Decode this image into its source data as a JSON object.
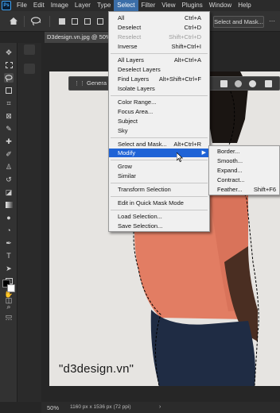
{
  "menubar": {
    "logo": "Ps",
    "items": [
      "File",
      "Edit",
      "Image",
      "Layer",
      "Type",
      "Select",
      "Filter",
      "View",
      "Plugins",
      "Window",
      "Help"
    ],
    "active": "Select"
  },
  "options": {
    "select_and_mask": "Select and Mask..."
  },
  "document": {
    "tab_title": "D3design.vn.jpg @ 50% (",
    "zoom": "50%",
    "dimensions": "1160 px x 1536 px (72 ppi)",
    "watermark": "\"d3design.vn\"",
    "context_label": "Genera"
  },
  "select_menu": {
    "all": {
      "label": "All",
      "shortcut": "Ctrl+A"
    },
    "deselect": {
      "label": "Deselect",
      "shortcut": "Ctrl+D"
    },
    "reselect": {
      "label": "Reselect",
      "shortcut": "Shift+Ctrl+D"
    },
    "inverse": {
      "label": "Inverse",
      "shortcut": "Shift+Ctrl+I"
    },
    "all_layers": {
      "label": "All Layers",
      "shortcut": "Alt+Ctrl+A"
    },
    "deselect_layers": {
      "label": "Deselect Layers",
      "shortcut": ""
    },
    "find_layers": {
      "label": "Find Layers",
      "shortcut": "Alt+Shift+Ctrl+F"
    },
    "isolate_layers": {
      "label": "Isolate Layers",
      "shortcut": ""
    },
    "color_range": {
      "label": "Color Range...",
      "shortcut": ""
    },
    "focus_area": {
      "label": "Focus Area...",
      "shortcut": ""
    },
    "subject": {
      "label": "Subject",
      "shortcut": ""
    },
    "sky": {
      "label": "Sky",
      "shortcut": ""
    },
    "select_and_mask": {
      "label": "Select and Mask...",
      "shortcut": "Alt+Ctrl+R"
    },
    "modify": {
      "label": "Modify",
      "shortcut": ""
    },
    "grow": {
      "label": "Grow",
      "shortcut": ""
    },
    "similar": {
      "label": "Similar",
      "shortcut": ""
    },
    "transform_selection": {
      "label": "Transform Selection",
      "shortcut": ""
    },
    "quick_mask": {
      "label": "Edit in Quick Mask Mode",
      "shortcut": ""
    },
    "load_selection": {
      "label": "Load Selection...",
      "shortcut": ""
    },
    "save_selection": {
      "label": "Save Selection...",
      "shortcut": ""
    }
  },
  "modify_submenu": {
    "border": {
      "label": "Border...",
      "shortcut": ""
    },
    "smooth": {
      "label": "Smooth...",
      "shortcut": ""
    },
    "expand": {
      "label": "Expand...",
      "shortcut": ""
    },
    "contract": {
      "label": "Contract...",
      "shortcut": ""
    },
    "feather": {
      "label": "Feather...",
      "shortcut": "Shift+F6"
    }
  },
  "colors": {
    "menu_highlight": "#1f63d6",
    "shirt": "#e27d63",
    "pants": "#1f2c44",
    "skin": "#4a2e22",
    "canvas_bg": "#e6e4e1"
  }
}
